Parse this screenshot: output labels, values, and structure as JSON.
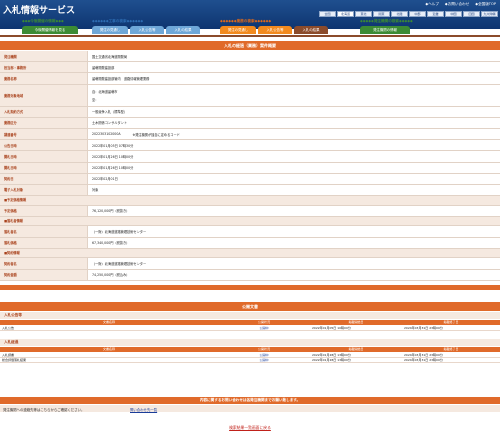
{
  "header": {
    "title": "入札情報サービス",
    "links": [
      "ヘルプ",
      "お問い合わせ",
      "全国版TOP"
    ],
    "regions": [
      "全国",
      "北海道",
      "東北",
      "関東",
      "北陸",
      "中部",
      "近畿",
      "中国",
      "四国",
      "九州沖縄"
    ],
    "active_region": 1
  },
  "categories": {
    "future": "今後開催の情報",
    "works": "工事の検索",
    "services": "業務の検索",
    "ordering": "発注機関の検索"
  },
  "nav_buttons": {
    "future_info": "今後開催情報を見る",
    "works_plan": "発注の見通し",
    "works_announce": "入札公告等",
    "works_result": "入札の結果",
    "services_plan": "発注の見通し",
    "services_announce": "入札公告等",
    "services_result": "入札の結果",
    "ordering_info": "発注機関の情報"
  },
  "detail": {
    "title": "入札の経過（業務）案件概要",
    "rows": [
      {
        "label": "発注機関",
        "value": "国土交通省北海道開発局"
      },
      {
        "label": "担当部・事務所",
        "value": "留萌開発建設部"
      },
      {
        "label": "業務名称",
        "value": "留萌開発建設部管内　道路情報管理業務"
      },
      {
        "label": "業務対象地域",
        "value": "自：北海道留萌市",
        "value2": "至："
      },
      {
        "label": "入札契約方式",
        "value": "一般競争入札（標準型）"
      },
      {
        "label": "業務区分",
        "value": "土木関係コンサルタント"
      },
      {
        "label": "調達番号",
        "value": "2022303102000A",
        "value2": "※発注機関が独自に定めるコード"
      },
      {
        "label": "公告日時",
        "value": "2022年01月05日 07時30分"
      },
      {
        "label": "開札日時",
        "value": "2022年01月26日 10時00分"
      },
      {
        "label": "開札日時",
        "value": "2022年01月26日 10時00分"
      },
      {
        "label": "契約日",
        "value": "2022年02月01日"
      },
      {
        "label": "電子入札対象",
        "value": "対象"
      }
    ],
    "price_group": "■予定価格情報",
    "price_rows": [
      {
        "label": "予定価格",
        "value": "76,120,000円（税抜き）"
      }
    ],
    "winner_group": "■落札者情報",
    "winner_rows": [
      {
        "label": "落札者名",
        "value": "（一財）北海道道路管理技術センター"
      },
      {
        "label": "落札価格",
        "value": "67,340,000円（税抜き）"
      }
    ],
    "contract_group": "■契約情報",
    "contract_rows": [
      {
        "label": "契約者名",
        "value": "（一財）北海道道路管理技術センター"
      },
      {
        "label": "契約金額",
        "value": "74,250,000円（税込み）"
      }
    ]
  },
  "public_docs": {
    "title": "公開文書",
    "announce_section": "入札公告等",
    "result_section": "入札経過",
    "columns": [
      "文書名称",
      "公開状況",
      "掲載開始日",
      "掲載終了日"
    ],
    "announce_rows": [
      {
        "name": "入札公告",
        "status": "公開中",
        "start": "2022年01月05日 10時00分",
        "end": "2024年03月31日 23時00分"
      }
    ],
    "result_rows": [
      {
        "name": "入札調書",
        "status": "公開中",
        "start": "2022年01月28日 13時00分",
        "end": "2024年03月31日 23時00分"
      },
      {
        "name": "総合評価落札結果",
        "status": "公開中",
        "start": "2022年01月28日 13時00分",
        "end": "2024年03月31日 23時00分"
      }
    ]
  },
  "inquiry": {
    "title": "内容に関するお問い合わせは各発注機関までお願い致します。",
    "text": "発注機関への連絡先等はこちらからご確認ください。",
    "link": "問い合わせ先一覧"
  },
  "back_link": "検索結果一覧画面に戻る"
}
